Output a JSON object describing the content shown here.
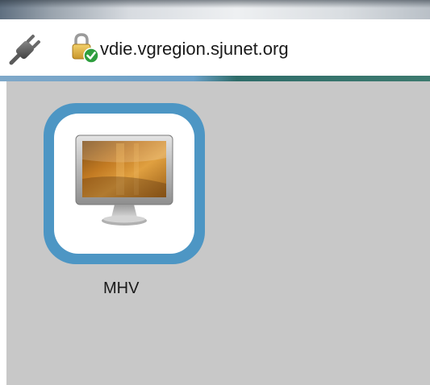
{
  "address_bar": {
    "host": "vdie.vgregion.sjunet.org",
    "connection_icon": "plug-icon",
    "security_icon": "lock-verified-icon"
  },
  "desktop": {
    "apps": [
      {
        "label": "MHV",
        "icon": "monitor-icon"
      }
    ]
  },
  "colors": {
    "tile_border": "#4d96c4",
    "desktop_background": "#c8c8c8",
    "verified_badge": "#2e9e3e"
  }
}
